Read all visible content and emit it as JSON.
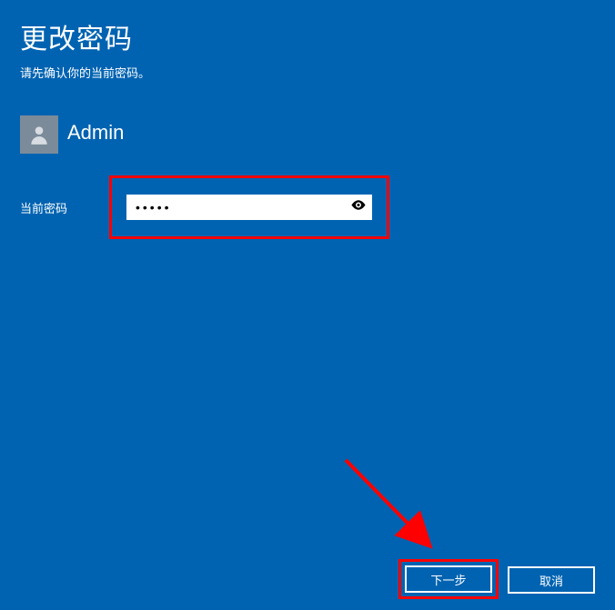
{
  "header": {
    "title": "更改密码",
    "subtitle": "请先确认你的当前密码。"
  },
  "user": {
    "name": "Admin"
  },
  "field": {
    "label": "当前密码",
    "value": "•••••",
    "placeholder": ""
  },
  "buttons": {
    "next": "下一步",
    "cancel": "取消"
  },
  "annotation": {
    "highlight_color": "#ff0000"
  }
}
